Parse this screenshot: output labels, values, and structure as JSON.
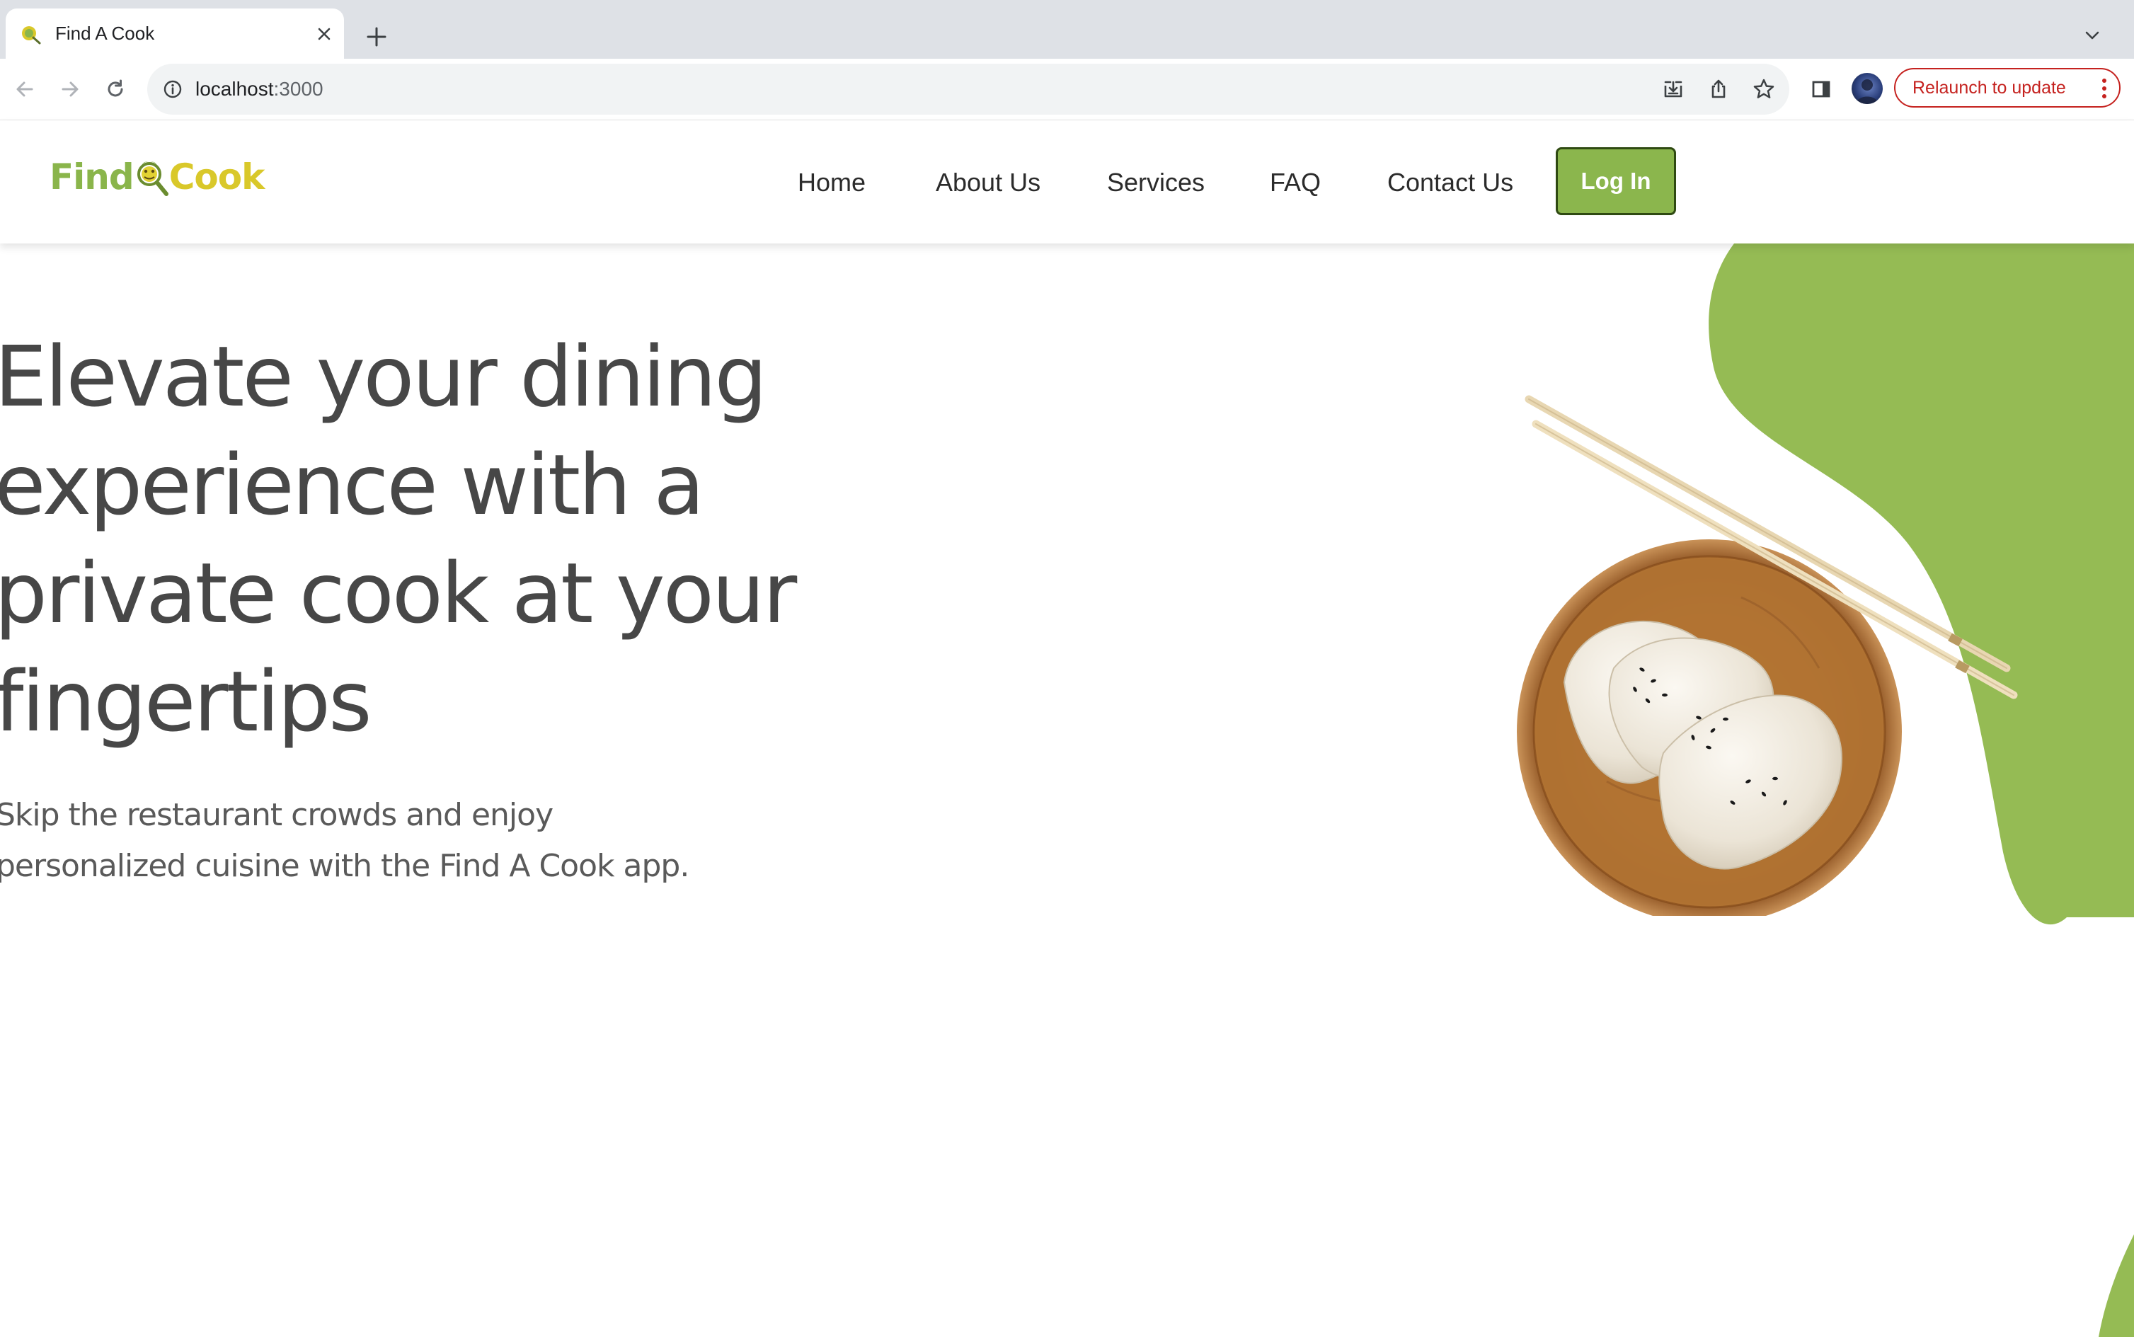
{
  "browser": {
    "tab_title": "Find A Cook",
    "url_host": "localhost",
    "url_port": ":3000",
    "relaunch_label": "Relaunch to update"
  },
  "site": {
    "logo": {
      "part1": "Find",
      "part2": "Cook"
    },
    "nav": [
      "Home",
      "About Us",
      "Services",
      "FAQ",
      "Contact Us"
    ],
    "login_label": "Log In",
    "hero": {
      "title": "Elevate your dining experience with a private cook at your fingertips",
      "title_lines": [
        "Elevate your dining",
        "experience with a",
        "private cook at your",
        "fingertips"
      ],
      "subtitle_lines": [
        "Skip the restaurant crowds and enjoy",
        "personalized cuisine with the Find A Cook app."
      ]
    },
    "colors": {
      "brand_green": "#8bb64d",
      "logo_yellow": "#d9c82a",
      "blob_green": "#95bb54",
      "text_dark": "#474747"
    }
  },
  "icons": {
    "back": "arrow-left-icon",
    "forward": "arrow-right-icon",
    "reload": "reload-icon",
    "info": "info-icon",
    "install": "install-icon",
    "share": "share-icon",
    "bookmark": "star-icon",
    "sidepanel": "side-panel-icon"
  }
}
